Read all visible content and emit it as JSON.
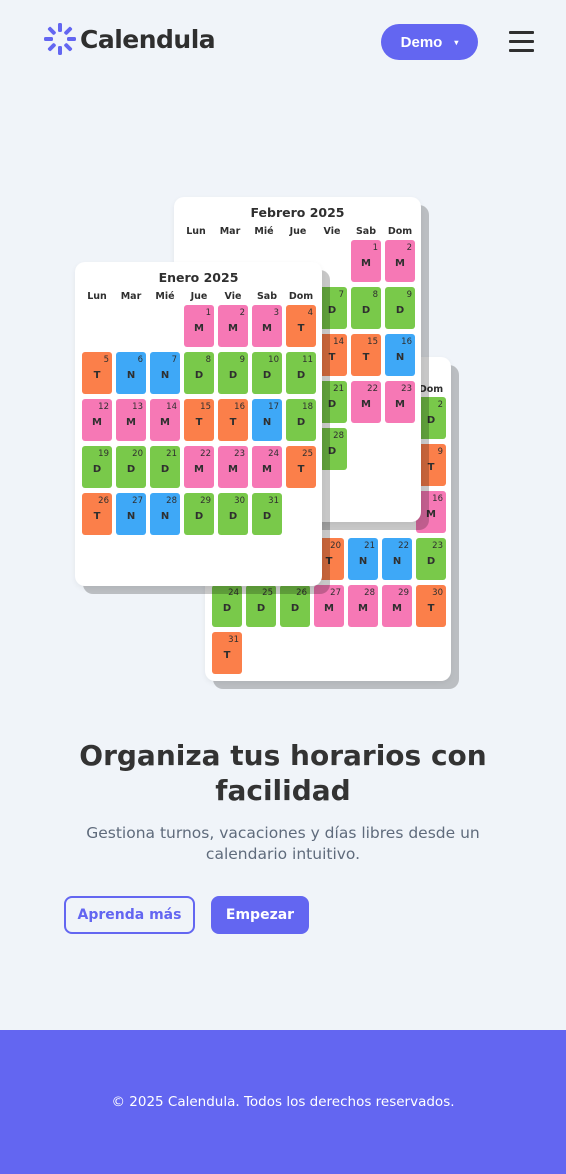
{
  "header": {
    "logo_text": "Calendula",
    "demo_label": "Demo",
    "demo_caret": "▾",
    "menu_icon": "hamburger-menu-icon"
  },
  "colors": {
    "accent": "#6366f1",
    "M": "#f678b5",
    "T": "#fb7f4a",
    "D": "#79c94a",
    "N": "#3ea8f7",
    "background": "#f0f4f9"
  },
  "calendars": {
    "weekdays": [
      "Lun",
      "Mar",
      "Mié",
      "Jue",
      "Vie",
      "Sab",
      "Dom"
    ],
    "enero": {
      "title": "Enero 2025",
      "days": [
        {
          "d": "1",
          "s": "M"
        },
        {
          "d": "2",
          "s": "M"
        },
        {
          "d": "3",
          "s": "M"
        },
        {
          "d": "4",
          "s": "T"
        },
        {
          "d": "5",
          "s": "T"
        },
        {
          "d": "6",
          "s": "N"
        },
        {
          "d": "7",
          "s": "N"
        },
        {
          "d": "8",
          "s": "D"
        },
        {
          "d": "9",
          "s": "D"
        },
        {
          "d": "10",
          "s": "D"
        },
        {
          "d": "11",
          "s": "D"
        },
        {
          "d": "12",
          "s": "M"
        },
        {
          "d": "13",
          "s": "M"
        },
        {
          "d": "14",
          "s": "M"
        },
        {
          "d": "15",
          "s": "T"
        },
        {
          "d": "16",
          "s": "T"
        },
        {
          "d": "17",
          "s": "N"
        },
        {
          "d": "18",
          "s": "D"
        },
        {
          "d": "19",
          "s": "D"
        },
        {
          "d": "20",
          "s": "D"
        },
        {
          "d": "21",
          "s": "D"
        },
        {
          "d": "22",
          "s": "M"
        },
        {
          "d": "23",
          "s": "M"
        },
        {
          "d": "24",
          "s": "M"
        },
        {
          "d": "25",
          "s": "T"
        },
        {
          "d": "26",
          "s": "T"
        },
        {
          "d": "27",
          "s": "N"
        },
        {
          "d": "28",
          "s": "N"
        },
        {
          "d": "29",
          "s": "D"
        },
        {
          "d": "30",
          "s": "D"
        },
        {
          "d": "31",
          "s": "D"
        }
      ]
    },
    "febrero": {
      "title": "Febrero 2025",
      "days": [
        {
          "d": "1",
          "s": "M"
        },
        {
          "d": "2",
          "s": "M"
        },
        {
          "d": "7",
          "s": "D"
        },
        {
          "d": "8",
          "s": "D"
        },
        {
          "d": "9",
          "s": "D"
        },
        {
          "d": "14",
          "s": "T"
        },
        {
          "d": "15",
          "s": "T"
        },
        {
          "d": "16",
          "s": "N"
        },
        {
          "d": "21",
          "s": "D"
        },
        {
          "d": "22",
          "s": "M"
        },
        {
          "d": "23",
          "s": "M"
        },
        {
          "d": "28",
          "s": "D"
        }
      ]
    },
    "marzo": {
      "dom_label": "Dom",
      "days": [
        {
          "d": "2",
          "s": "D"
        },
        {
          "d": "9",
          "s": "T"
        },
        {
          "d": "16",
          "s": "M"
        },
        {
          "d": "20",
          "s": "T"
        },
        {
          "d": "21",
          "s": "N"
        },
        {
          "d": "22",
          "s": "N"
        },
        {
          "d": "23",
          "s": "D"
        },
        {
          "d": "24",
          "s": "D"
        },
        {
          "d": "25",
          "s": "D"
        },
        {
          "d": "26",
          "s": "D"
        },
        {
          "d": "27",
          "s": "M"
        },
        {
          "d": "28",
          "s": "M"
        },
        {
          "d": "29",
          "s": "M"
        },
        {
          "d": "30",
          "s": "T"
        },
        {
          "d": "31",
          "s": "T"
        }
      ]
    }
  },
  "hero": {
    "headline": "Organiza tus horarios con facilidad",
    "subline": "Gestiona turnos, vacaciones y días libres desde un calendario intuitivo.",
    "learn_more": "Aprenda más",
    "start": "Empezar"
  },
  "footer": {
    "text": "© 2025 Calendula. Todos los derechos reservados."
  }
}
